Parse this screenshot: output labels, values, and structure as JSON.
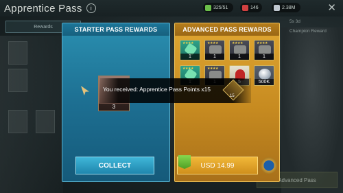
{
  "header": {
    "title": "Apprentice Pass",
    "info_icon": "i",
    "resources": [
      {
        "icon": "energy-icon",
        "value": "325/51",
        "color": "#6bbf4a"
      },
      {
        "icon": "gem-icon",
        "value": "146",
        "color": "#d04040"
      },
      {
        "icon": "silver-icon",
        "value": "2.38M",
        "color": "#c0c8d0"
      }
    ],
    "close_icon": "✕"
  },
  "background": {
    "rewards_tab": "Rewards",
    "timer": "5s 3d",
    "champion_reward": "Champion Reward",
    "advanced_pass_button": "Advanced Pass",
    "count_label": "1"
  },
  "starter_panel": {
    "title": "STARTER PASS REWARDS",
    "collect_label": "COLLECT",
    "item_count": "3"
  },
  "advanced_panel": {
    "title": "ADVANCED PASS REWARDS",
    "price_label": "USD 14.99",
    "items": [
      {
        "kind": "green",
        "count": "1"
      },
      {
        "kind": "gray",
        "count": "1"
      },
      {
        "kind": "gray",
        "count": "1"
      },
      {
        "kind": "gray",
        "count": "1"
      },
      {
        "kind": "green",
        "count": "1"
      },
      {
        "kind": "gray",
        "count": "1"
      },
      {
        "kind": "red",
        "count": "5"
      },
      {
        "kind": "silver",
        "count": "500K"
      }
    ]
  },
  "toast": {
    "message": "You received: Apprentice Pass Points x15",
    "badge_count": "15"
  }
}
